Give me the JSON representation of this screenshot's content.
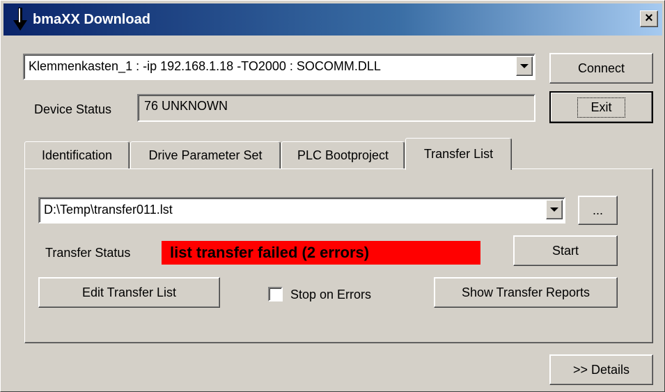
{
  "window": {
    "title": "bmaXX Download",
    "close_label": "×"
  },
  "connection": {
    "value": "Klemmenkasten_1 : -ip 192.168.1.18 -TO2000 : SOCOMM.DLL",
    "connect_label": "Connect",
    "exit_label": "Exit"
  },
  "device_status": {
    "label": "Device Status",
    "value": "76  UNKNOWN"
  },
  "tabs": [
    {
      "label": "Identification",
      "active": false
    },
    {
      "label": "Drive Parameter Set",
      "active": false
    },
    {
      "label": "PLC Bootproject",
      "active": false
    },
    {
      "label": "Transfer List",
      "active": true
    }
  ],
  "transfer": {
    "file_value": "D:\\Temp\\transfer011.lst",
    "browse_label": "...",
    "status_label": "Transfer Status",
    "status_value": "list transfer failed (2 errors)",
    "status_color": "#ff0000",
    "start_label": "Start",
    "edit_label": "Edit Transfer List",
    "stop_on_errors_label": "Stop on Errors",
    "stop_on_errors_checked": false,
    "show_reports_label": "Show Transfer Reports"
  },
  "footer": {
    "details_label": ">> Details"
  }
}
